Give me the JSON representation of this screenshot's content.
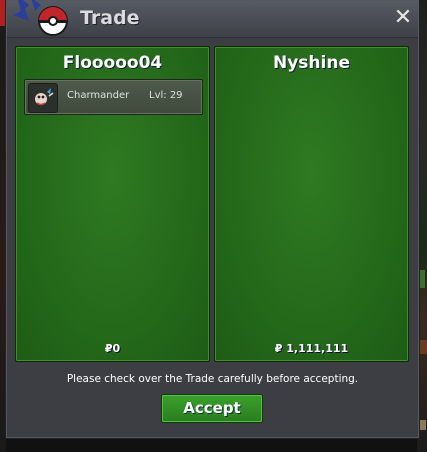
{
  "window": {
    "title": "Trade",
    "close_icon": "close-icon"
  },
  "left_panel": {
    "player_name": "Flooooo04",
    "items": [
      {
        "name": "Charmander",
        "level": "Lvl: 29",
        "icon": "pokemon-icon"
      }
    ],
    "money": "₽0"
  },
  "right_panel": {
    "player_name": "Nyshine",
    "items": [],
    "money": "₽ 1,111,111"
  },
  "footer": {
    "notice": "Please check over the Trade carefully before accepting.",
    "accept_label": "Accept"
  },
  "colors": {
    "panel_green": "#256a1b",
    "window_gray": "#3c3e44",
    "accept_green": "#2a7d1f"
  }
}
